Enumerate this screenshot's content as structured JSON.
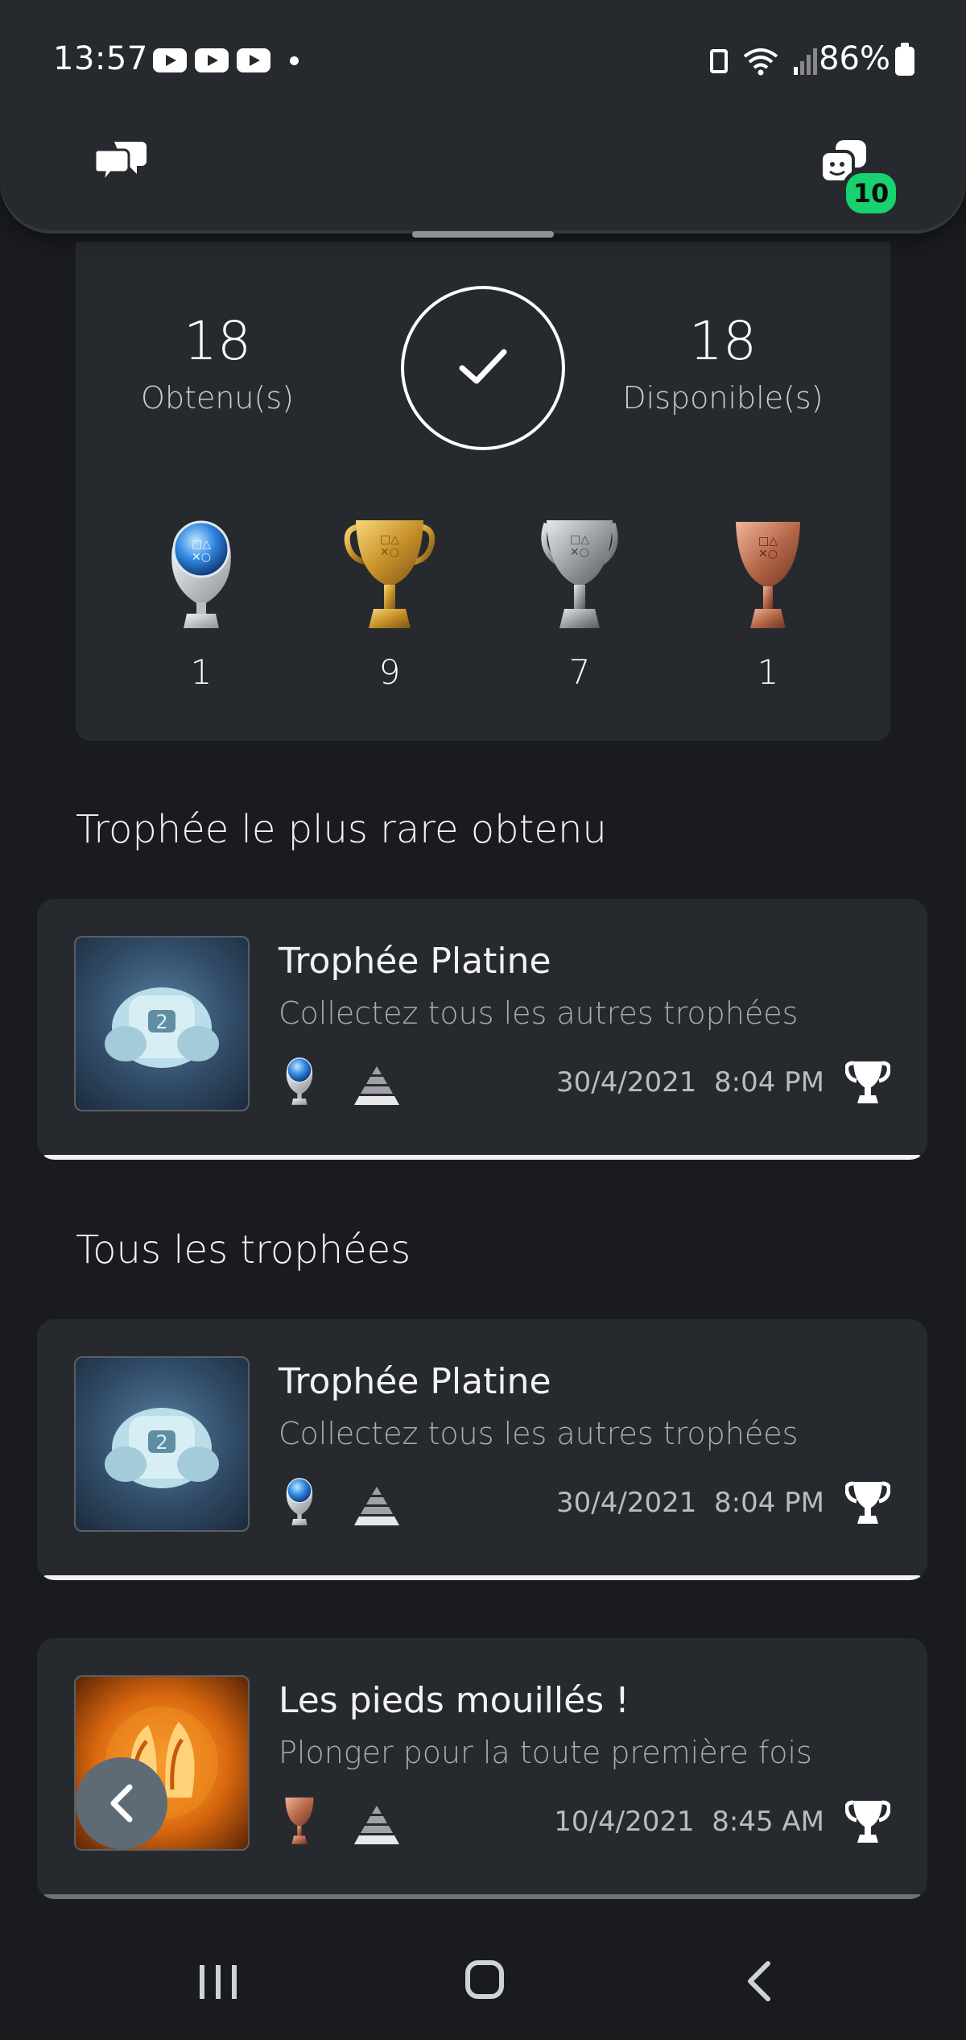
{
  "status_bar": {
    "time": "13:57",
    "battery": "86%",
    "icons": [
      "youtube-icon",
      "youtube-icon",
      "youtube-icon",
      "dot-icon",
      "sim-icon",
      "wifi-icon",
      "signal-icon",
      "battery-charging-icon"
    ]
  },
  "header": {
    "left_icon": "chat-bubbles-icon",
    "right_icon": "friends-icon",
    "friends_badge": "10",
    "accent": "#17d26f"
  },
  "summary": {
    "earned_count": "18",
    "earned_label": "Obtenu(s)",
    "available_count": "18",
    "available_label": "Disponible(s)",
    "completion_icon": "checkmark-icon",
    "grades": [
      {
        "grade": "platinum",
        "count": "1"
      },
      {
        "grade": "gold",
        "count": "9"
      },
      {
        "grade": "silver",
        "count": "7"
      },
      {
        "grade": "bronze",
        "count": "1"
      }
    ]
  },
  "rarest_section": {
    "title": "Trophée le plus rare obtenu",
    "trophy": {
      "title": "Trophée Platine",
      "description": "Collectez tous les autres trophées",
      "grade": "platinum",
      "rarity_icon": "rarity-pyramid-icon",
      "date": "30/4/2021",
      "time": "8:04 PM"
    }
  },
  "all_section": {
    "title": "Tous les trophées",
    "trophies": [
      {
        "title": "Trophée Platine",
        "description": "Collectez tous les autres trophées",
        "grade": "platinum",
        "date": "30/4/2021",
        "time": "8:04 PM"
      },
      {
        "title": "Les pieds mouillés !",
        "description": "Plonger pour la toute première fois",
        "grade": "bronze",
        "date": "10/4/2021",
        "time": "8:45 AM"
      }
    ]
  },
  "grade_colors": {
    "platinum": "#5aa8ff",
    "gold": "#d4a23a",
    "silver": "#a9adb3",
    "bronze": "#c7785a"
  }
}
